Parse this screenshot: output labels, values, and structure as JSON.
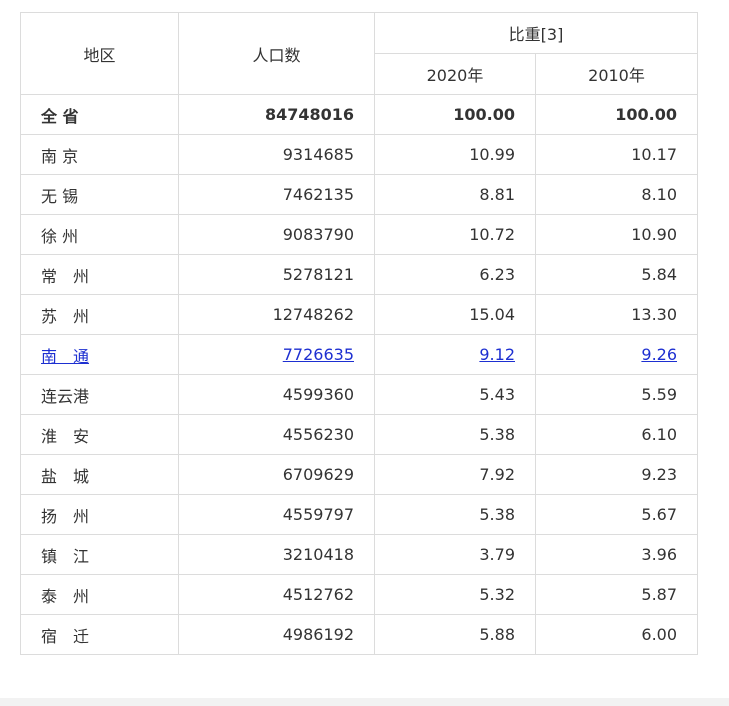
{
  "header": {
    "region": "地区",
    "population": "人口数",
    "share": "比重[3]",
    "year2020": "2020年",
    "year2010": "2010年"
  },
  "rows": [
    {
      "region": "全 省",
      "population": "84748016",
      "y2020": "100.00",
      "y2010": "100.00"
    },
    {
      "region": "南 京",
      "population": "9314685",
      "y2020": "10.99",
      "y2010": "10.17"
    },
    {
      "region": "无 锡",
      "population": "7462135",
      "y2020": "8.81",
      "y2010": "8.10"
    },
    {
      "region": "徐 州",
      "population": "9083790",
      "y2020": "10.72",
      "y2010": "10.90"
    },
    {
      "region": "常　州",
      "population": "5278121",
      "y2020": "6.23",
      "y2010": "5.84"
    },
    {
      "region": "苏　州",
      "population": "12748262",
      "y2020": "15.04",
      "y2010": "13.30"
    },
    {
      "region": "南　通",
      "population": "7726635",
      "y2020": "9.12",
      "y2010": "9.26"
    },
    {
      "region": "连云港",
      "population": "4599360",
      "y2020": "5.43",
      "y2010": "5.59"
    },
    {
      "region": "淮　安",
      "population": "4556230",
      "y2020": "5.38",
      "y2010": "6.10"
    },
    {
      "region": "盐　城",
      "population": "6709629",
      "y2020": "7.92",
      "y2010": "9.23"
    },
    {
      "region": "扬　州",
      "population": "4559797",
      "y2020": "5.38",
      "y2010": "5.67"
    },
    {
      "region": "镇　江",
      "population": "3210418",
      "y2020": "3.79",
      "y2010": "3.96"
    },
    {
      "region": "泰　州",
      "population": "4512762",
      "y2020": "5.32",
      "y2010": "5.87"
    },
    {
      "region": "宿　迁",
      "population": "4986192",
      "y2020": "5.88",
      "y2010": "6.00"
    }
  ],
  "colors": {
    "link": "#1d2fd1",
    "border": "#dcdcdc",
    "text": "#333333"
  }
}
